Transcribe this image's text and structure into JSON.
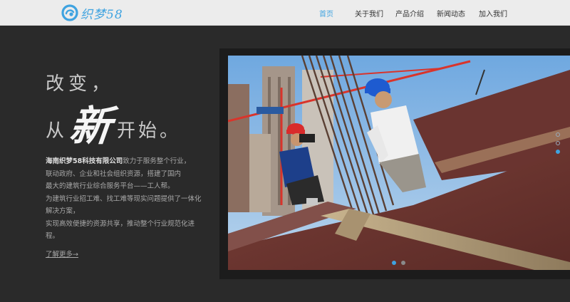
{
  "header": {
    "logo_text": "织梦58",
    "nav": [
      {
        "label": "首页",
        "active": true
      },
      {
        "label": "关于我们",
        "active": false
      },
      {
        "label": "产品介绍",
        "active": false
      },
      {
        "label": "新闻动态",
        "active": false
      },
      {
        "label": "加入我们",
        "active": false
      }
    ]
  },
  "hero": {
    "headline_line1": "改变，",
    "headline_pre": "从",
    "headline_big": "新",
    "headline_post": "开始。",
    "company_name": "海南织梦58科技有限公司",
    "desc_lines": [
      "致力于服务整个行业，",
      "联动政府、企业和社会组织资源，搭建了国内",
      "最大的建筑行业综合服务平台——工人帮。",
      "为建筑行业招工难、找工难等现实问题提供了一体化",
      "解决方案，",
      "实现高效便捷的资源共享，推动整个行业规范化进",
      "程。"
    ],
    "more_link": "了解更多→"
  },
  "slider": {
    "image_alt": "construction site photo",
    "vertical_dots": 3,
    "active_vertical_dot": 3,
    "horizontal_dots": 2,
    "active_horizontal_dot": 1
  },
  "colors": {
    "accent": "#3fa3e0",
    "background": "#2a2a2a",
    "header_bg": "#ececec"
  }
}
